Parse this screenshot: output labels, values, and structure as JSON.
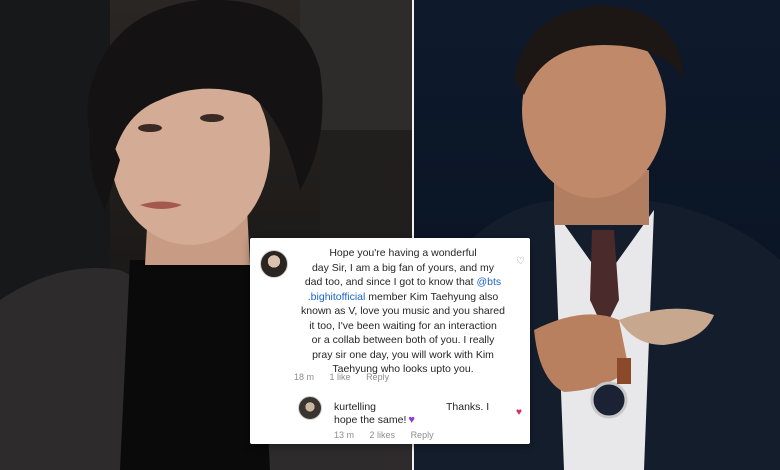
{
  "comment": {
    "avatar_icon": "profile-avatar-icon",
    "line1": "Hope you're having a wonderful",
    "line2": "day Sir, I am a big fan of yours, and my",
    "line3": "dad too, and since I got to know that ",
    "mention_part1": "@bts",
    "mention_part2": ".bighitofficial",
    "line4_rest": " member Kim Taehyung also",
    "line5": "known as V, love you music and you shared",
    "line6": "it too, I've been waiting for an interaction",
    "line7": "or a collab between both of you. I really",
    "line8": "pray sir one day, you will work with Kim",
    "line9": "Taehyung who looks upto you.",
    "time": "18 m",
    "likes": "1 like",
    "reply": "Reply",
    "like_icon": "heart-outline-icon"
  },
  "reply": {
    "avatar_icon": "profile-avatar-icon",
    "username": "kurtelling",
    "text1": "Thanks. I",
    "text2": "hope the same!",
    "emoji_icon": "purple-heart-emoji",
    "time": "13 m",
    "likes": "2 likes",
    "reply": "Reply",
    "like_icon": "heart-filled-icon"
  },
  "colors": {
    "mention": "#1a64c8",
    "liked_heart": "#e0245e",
    "purple_heart": "#8e3ad8"
  }
}
